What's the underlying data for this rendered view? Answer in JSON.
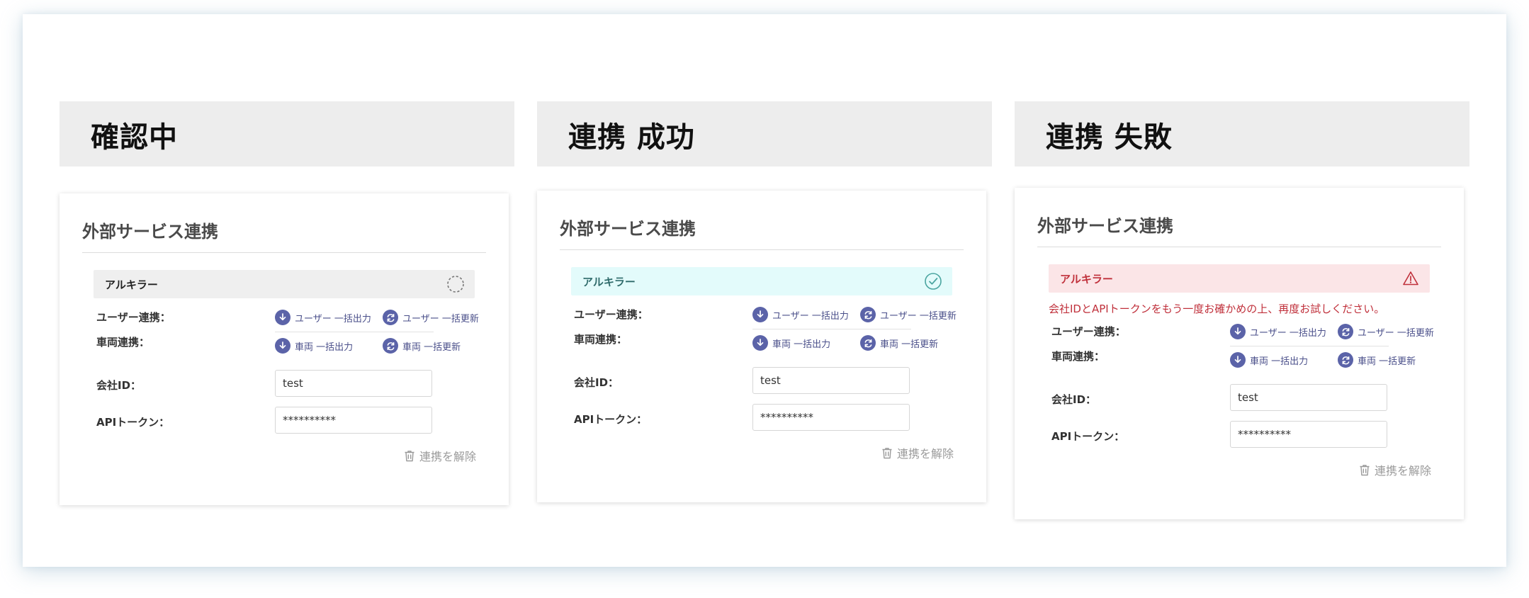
{
  "card_title": "外部サービス連携",
  "service_name": "アルキラー",
  "labels": {
    "user_link": "ユーザー連携：",
    "vehicle_link": "車両連携：",
    "company_id": "会社ID：",
    "api_token": "APIトークン："
  },
  "actions": {
    "user_export": "ユーザー 一括出力",
    "user_update": "ユーザー 一括更新",
    "vehicle_export": "車両 一括出力",
    "vehicle_update": "車両 一括更新"
  },
  "fields": {
    "company_id_value": "test",
    "api_token_value": "**********"
  },
  "unlink_label": "連携を解除",
  "states": [
    {
      "title": "確認中",
      "status": "pending",
      "status_icon": "spinner-icon"
    },
    {
      "title": "連携 成功",
      "status": "success",
      "status_icon": "check-circle-icon"
    },
    {
      "title": "連携 失敗",
      "status": "error",
      "status_icon": "warning-icon",
      "error_message": "会社IDとAPIトークンをもう一度お確かめの上、再度お試しください。"
    }
  ],
  "colors": {
    "header_bg": "#ededed",
    "pending_bar": "#efefef",
    "success_bar": "#e3fbfb",
    "success_accent": "#4aa5a0",
    "error_bar": "#fbe5e7",
    "error_text": "#c0303b",
    "action_icon": "#5b63a8"
  }
}
